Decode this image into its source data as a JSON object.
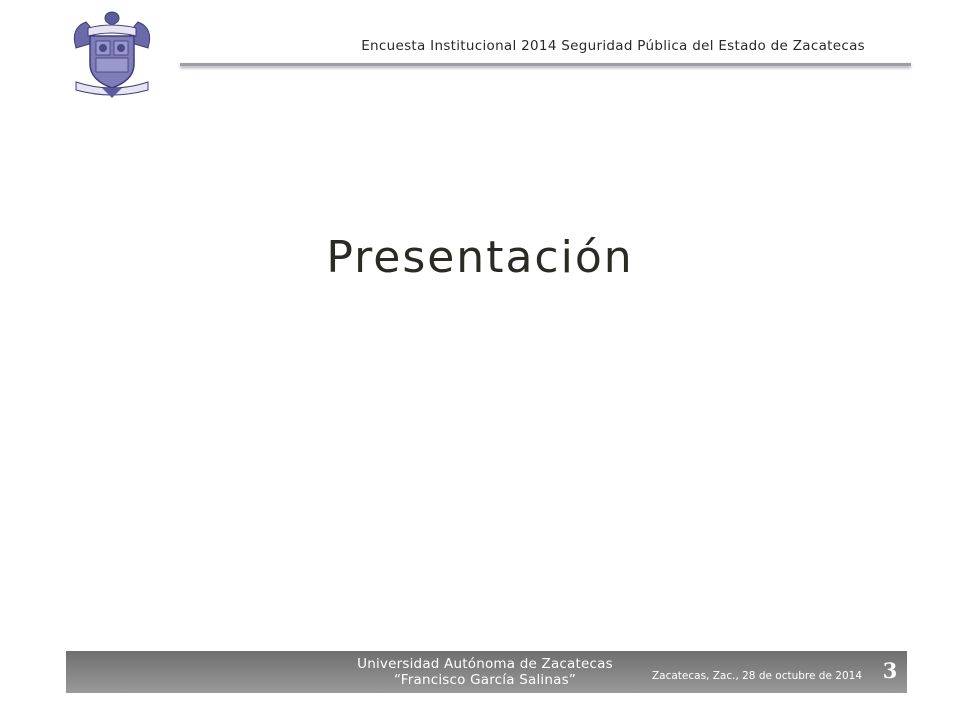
{
  "header": {
    "title": "Encuesta Institucional 2014 Seguridad Pública del Estado de Zacatecas",
    "logo_icon": "university-seal-icon",
    "logo_color": "#4b4a8a"
  },
  "main": {
    "title": "Presentación"
  },
  "footer": {
    "university_line1": "Universidad Autónoma de Zacatecas",
    "university_line2": "“Francisco García Salinas”",
    "date": "Zacatecas, Zac., 28 de octubre de 2014",
    "page_number": "3",
    "bar_color": "#808080"
  }
}
